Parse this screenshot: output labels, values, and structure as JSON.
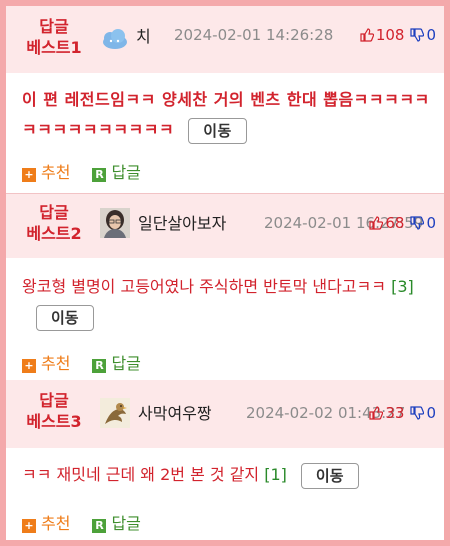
{
  "posts": [
    {
      "best_line1": "답글",
      "best_line2": "베스트1",
      "nickname": "치",
      "date": "2024-02-01 14:26:28",
      "up": "108",
      "down": "0",
      "content": "이 편 레전드임ㅋㅋ 양세찬 거의 벤츠 한대 뽑음ㅋㅋㅋㅋㅋㅋㅋㅋㅋㅋㅋㅋㅋㅋㅋ",
      "reply_count": "",
      "move": "이동",
      "recommend": "추천",
      "reply": "답글"
    },
    {
      "best_line1": "답글",
      "best_line2": "베스트2",
      "nickname": "일단살아보자",
      "date": "2024-02-01 16:27:59",
      "up": "68",
      "down": "0",
      "content": "왕코형 별명이 고등어였나 주식하면 반토막 낸다고ㅋㅋ",
      "reply_count": "[3]",
      "move": "이동",
      "recommend": "추천",
      "reply": "답글"
    },
    {
      "best_line1": "답글",
      "best_line2": "베스트3",
      "nickname": "사막여우짱",
      "date": "2024-02-02 01:43:27",
      "up": "33",
      "down": "0",
      "content": "ㅋㅋ 재밋네 근데 왜 2번 본 것 같지",
      "reply_count": "[1]",
      "move": "이동",
      "recommend": "추천",
      "reply": "답글"
    }
  ],
  "colors": {
    "accent_red": "#d2232d",
    "header_bg": "#fde8e9",
    "border_pink": "#f4a9ab",
    "recommend_orange": "#ef7d1a",
    "reply_green": "#4da13a",
    "down_blue": "#1d3fbf"
  },
  "icons": [
    "cloud-avatar",
    "person-avatar",
    "bird-avatar",
    "thumbs-up-icon",
    "thumbs-down-icon",
    "plus-icon",
    "reply-r-icon"
  ]
}
